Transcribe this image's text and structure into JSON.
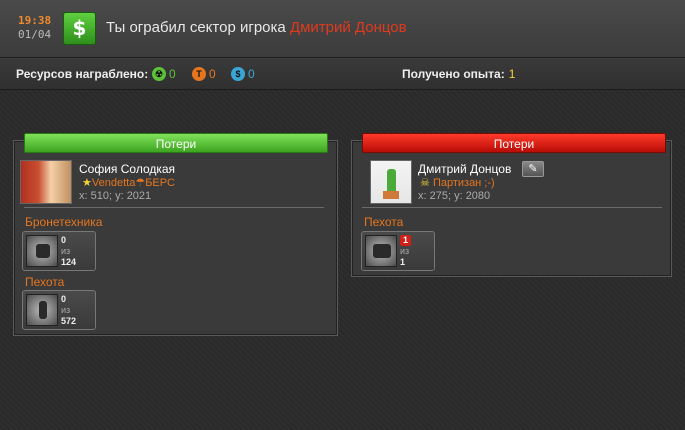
{
  "header": {
    "time": "19:38",
    "date": "01/04",
    "message": "Ты ограбил сектор игрока ",
    "victim_name": "Дмитрий Донцов"
  },
  "stats": {
    "resources_label": "Ресурсов награблено:",
    "resources": [
      {
        "icon": "radiation-icon",
        "value": "0",
        "color": "#5ec13a"
      },
      {
        "icon": "titanium-icon",
        "value": "0",
        "color": "#e5761f"
      },
      {
        "icon": "dollar-icon",
        "value": "0",
        "color": "#3aa6d6"
      }
    ],
    "exp_label": "Получено опыта:",
    "exp_value": "1"
  },
  "left_panel": {
    "header": "Потери",
    "player_name": "София Солодкая",
    "alliance": "Vendetta",
    "alliance_suffix": "БЕРС",
    "coords": "x: 510; y: 2021",
    "categories": [
      {
        "title": "Бронетехника",
        "unit": {
          "icon": "armored-vehicle-icon",
          "lost": "0",
          "of": "из",
          "total": "124"
        }
      },
      {
        "title": "Пехота",
        "unit": {
          "icon": "infantry-icon",
          "lost": "0",
          "of": "из",
          "total": "572"
        }
      }
    ]
  },
  "right_panel": {
    "header": "Потери",
    "player_name": "Дмитрий Донцов",
    "alliance": "Партизан ;-)",
    "coords": "x: 275; y: 2080",
    "categories": [
      {
        "title": "Пехота",
        "unit": {
          "icon": "infantry-spider-icon",
          "lost": "1",
          "of": "из",
          "total": "1"
        }
      }
    ]
  }
}
